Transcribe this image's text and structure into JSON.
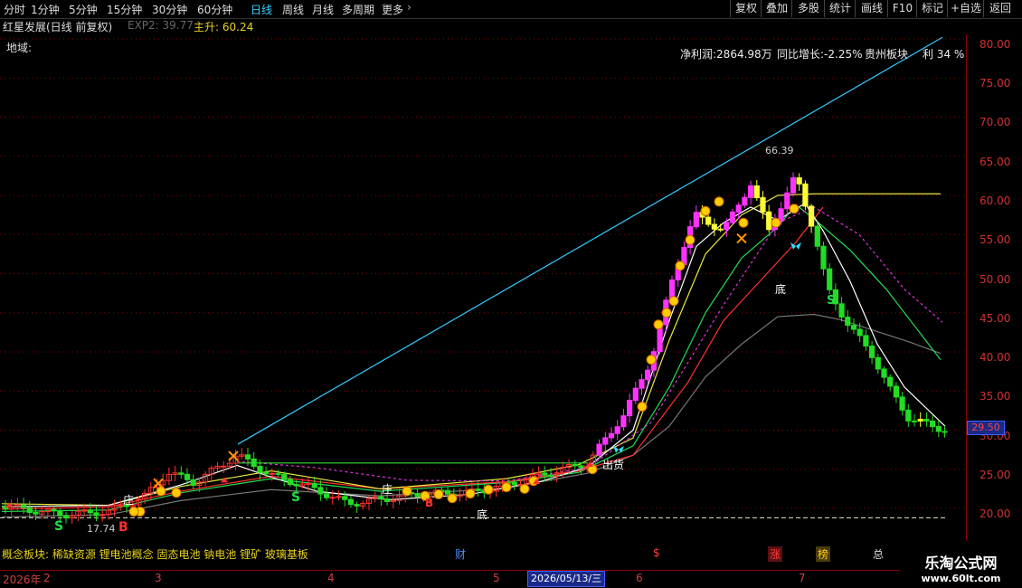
{
  "toolbar": {
    "periods": [
      "分时",
      "1分钟",
      "5分钟",
      "15分钟",
      "30分钟",
      "60分钟",
      "日线",
      "周线",
      "月线",
      "多周期",
      "更多"
    ],
    "active_period": "日线",
    "buttons": [
      "复权",
      "叠加",
      "多股",
      "统计",
      "画线",
      "F10",
      "标记",
      "+自选",
      "返回"
    ]
  },
  "info": {
    "stock": "红星发展(日线 前复权)",
    "exp2": "EXP2: 39.77",
    "main_up": "主升: 60.24",
    "region": "地域:",
    "net_profit": "净利润:2864.98万",
    "yoy": "同比增长:-2.25%",
    "sector": "贵州板块",
    "profit_pct": "利 34 %"
  },
  "price_axis": {
    "ticks": [
      "80.00",
      "75.00",
      "70.00",
      "65.00",
      "60.00",
      "55.00",
      "50.00",
      "45.00",
      "40.00",
      "35.00",
      "30.00",
      "25.00",
      "20.00"
    ],
    "current_price": "29.50"
  },
  "annotations": {
    "high_label": "66.39",
    "low_label": "17.74",
    "zhuang1": "庄",
    "zhuang2": "庄",
    "chuhuo": "出货",
    "di1": "底",
    "di2": "底",
    "s1": "S",
    "s2": "S",
    "s3": "S",
    "b1": "B",
    "b2": "B"
  },
  "bottom": {
    "concepts": "概念板块: 稀缺资源 锂电池概念 固态电池 钠电池 锂矿 玻璃基板",
    "markers": [
      "财",
      "$",
      "涨",
      "榜",
      "总"
    ]
  },
  "timeline": {
    "labels": [
      "2026年",
      "2",
      "3",
      "4",
      "5",
      "6",
      "7"
    ],
    "cursor_date": "2026/05/13/三"
  },
  "watermark": {
    "line1": "乐淘公式网",
    "line2": "www.60lt.com"
  },
  "colors": {
    "up": "#ff33ff",
    "down": "#ffff33",
    "axis": "#d03030",
    "trend": "#33ccff"
  }
}
